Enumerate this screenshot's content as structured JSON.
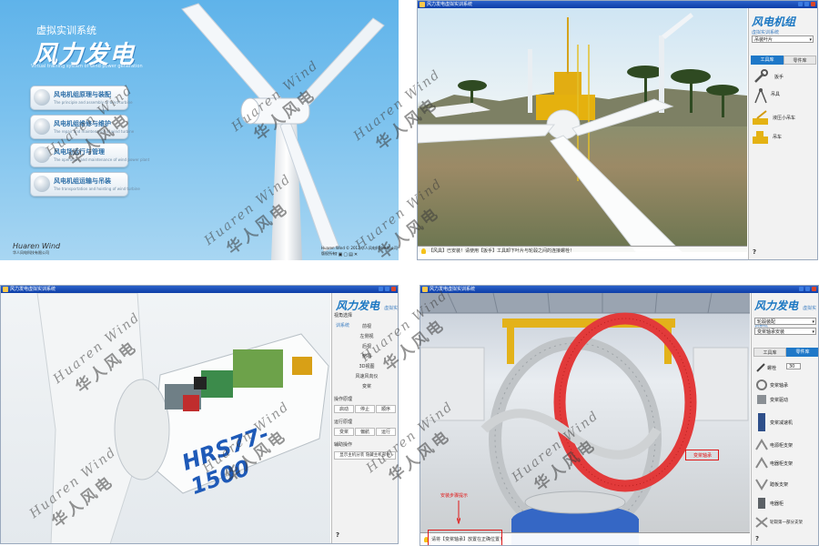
{
  "panel1": {
    "subtitle": "虚拟实训系统",
    "title": "风力发电",
    "english": "Virtual training system of wind power generation",
    "menu": [
      {
        "label": "风电机组原理与装配",
        "en": "The principle and assembly of wind turbine"
      },
      {
        "label": "风电机组维修与维护",
        "en": "The repair and maintenance of wind turbine"
      },
      {
        "label": "风电场运行与管理",
        "en": "The operation and maintenance of wind power plant"
      },
      {
        "label": "风电机组运输与吊装",
        "en": "The transportation and hoisting of wind turbine"
      }
    ],
    "logo": "Huaren Wind",
    "logo_cn": "华人风电科技有限公司",
    "status": "Huaren Wind © 2013 华人风电科技有限公司版权所有",
    "tray": "?▣▢▤✕"
  },
  "panel2": {
    "window_title": "风力发电虚拟实训系统",
    "brand": "风电机组",
    "brand_sub": "虚拟实训系统",
    "select_value": "吊装叶片",
    "tabs": [
      "工具库",
      "零件库"
    ],
    "tools": [
      "扳手",
      "吊具",
      "液压小吊车",
      "吊车"
    ],
    "hint": "【风具】已安装！请使用【扳手】工具卸下叶片与轮毂之间的连接螺栓！",
    "help": "?"
  },
  "panel3": {
    "window_title": "风力发电虚拟实训系统",
    "brand": "风力发电",
    "brand_sub": "虚拟实训系统",
    "section_view": "视角选择",
    "views": [
      "前视",
      "左侧视",
      "后视",
      "俯视",
      "3D视图",
      "风速风向仪",
      "变桨"
    ],
    "section_operate": "操作原理",
    "operate_buttons": [
      "启动",
      "停止",
      "顺序"
    ],
    "section_run": "运行原理",
    "run_buttons": [
      "变桨",
      "偏航",
      "运行"
    ],
    "section_assist": "辅助操作",
    "assist_button": "显示主机分装 隐藏主机部件",
    "nacelle_label": "HRS77-1500",
    "help": "?"
  },
  "panel4": {
    "window_title": "风力发电虚拟实训系统",
    "brand": "风力发电",
    "brand_sub": "虚拟实训系统",
    "select1": "轮毂装配",
    "select2": "变桨轴承安装",
    "tabs": [
      "工具库",
      "零件库"
    ],
    "parts": [
      "螺栓",
      "变桨轴承",
      "变桨驱动",
      "变桨减速机",
      "电源柜支架",
      "电器柜支架",
      "踏板支架",
      "电器柜",
      "轮毂第一部分支架"
    ],
    "stepper": "30",
    "hint": "请将【变桨轴承】放置在正确位置！",
    "red_label_step": "安装步骤提示",
    "red_label_part": "变桨轴承",
    "help": "?"
  },
  "watermark": {
    "en": "Huaren Wind",
    "cn": "华人风电"
  }
}
